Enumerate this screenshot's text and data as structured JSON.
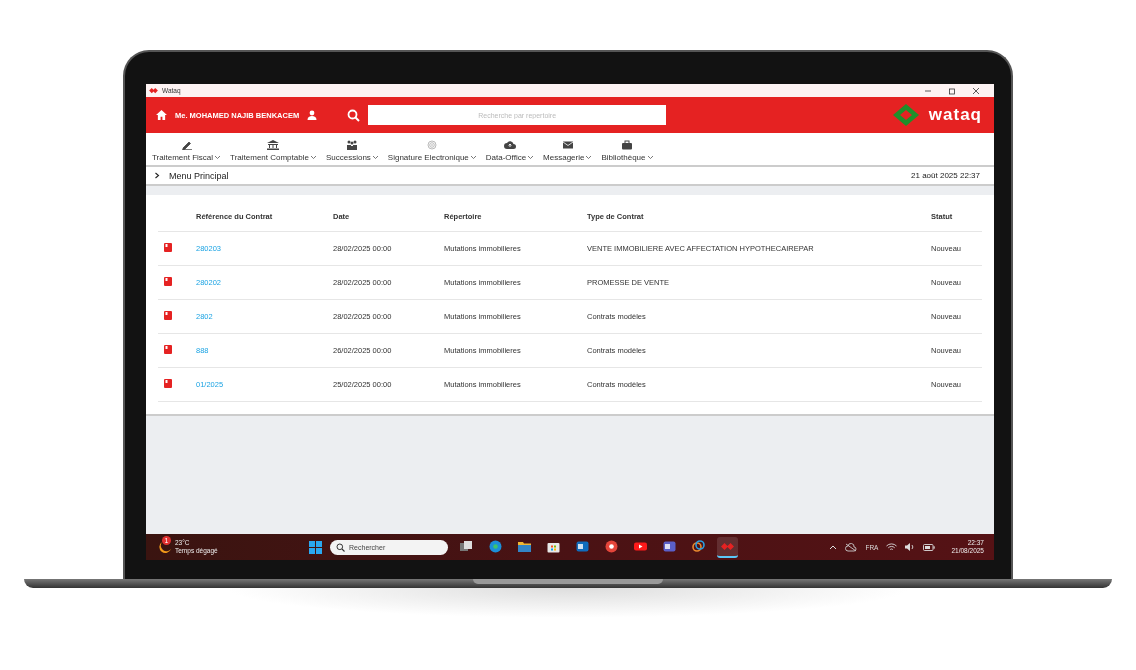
{
  "window": {
    "title": "Wataq"
  },
  "header": {
    "user": "Me. MOHAMED NAJIB BENKACEM",
    "search": {
      "placeholder": "Recherche par repertoire"
    },
    "logo": "wataq"
  },
  "menu": [
    {
      "label": "Traitement Fiscal",
      "kind": "pen"
    },
    {
      "label": "Traitement Comptable",
      "kind": "bank"
    },
    {
      "label": "Successions",
      "kind": "people"
    },
    {
      "label": "Signature Electronique",
      "kind": "fingerprint"
    },
    {
      "label": "Data-Office",
      "kind": "cloud"
    },
    {
      "label": "Messagerie",
      "kind": "mail"
    },
    {
      "label": "Bibliothèque",
      "kind": "briefcase"
    }
  ],
  "breadcrumb": {
    "label": "Menu Principal",
    "datetime": "21 août 2025 22:37"
  },
  "table": {
    "columns": [
      "Référence du Contrat",
      "Date",
      "Répertoire",
      "Type de Contrat",
      "Statut"
    ],
    "rows": [
      [
        "280203",
        "28/02/2025 00:00",
        "Mutations immobilieres",
        "VENTE IMMOBILIERE AVEC AFFECTATION HYPOTHECAIREPAR",
        "Nouveau"
      ],
      [
        "280202",
        "28/02/2025 00:00",
        "Mutations immobilieres",
        "PROMESSE DE VENTE",
        "Nouveau"
      ],
      [
        "2802",
        "28/02/2025 00:00",
        "Mutations immobilieres",
        "Contrats modèles",
        "Nouveau"
      ],
      [
        "888",
        "26/02/2025 00:00",
        "Mutations immobilieres",
        "Contrats modèles",
        "Nouveau"
      ],
      [
        "01/2025",
        "25/02/2025 00:00",
        "Mutations immobilieres",
        "Contrats modèles",
        "Nouveau"
      ]
    ]
  },
  "taskbar": {
    "weather": {
      "badge": "1",
      "temperature": "23°C",
      "condition": "Temps dégagé"
    },
    "search": {
      "placeholder": "Rechercher"
    },
    "apps": [
      {
        "kind": "taskview",
        "active": false
      },
      {
        "kind": "edge",
        "active": false
      },
      {
        "kind": "folder",
        "active": false
      },
      {
        "kind": "store",
        "active": false
      },
      {
        "kind": "outlook",
        "active": false
      },
      {
        "kind": "chrome",
        "active": false
      },
      {
        "kind": "youtube",
        "active": false
      },
      {
        "kind": "teams",
        "active": false
      },
      {
        "kind": "copilot",
        "active": false
      },
      {
        "kind": "wataq",
        "active": true
      }
    ],
    "language": "FRA",
    "time": "22:37",
    "date": "21/08/2025"
  }
}
